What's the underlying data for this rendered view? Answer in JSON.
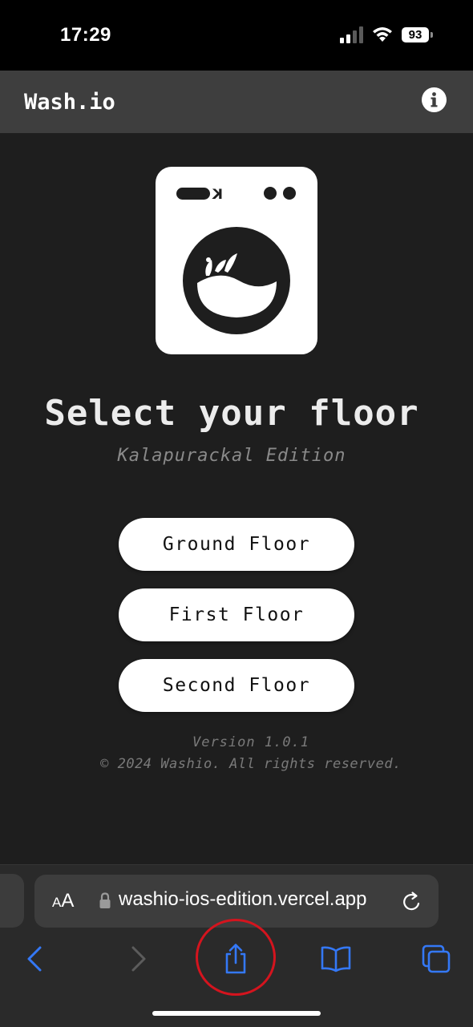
{
  "status_bar": {
    "time": "17:29",
    "battery_level": "93",
    "icons": [
      "signal-icon",
      "wifi-icon",
      "battery-icon"
    ]
  },
  "header": {
    "title": "Wash.io",
    "info_icon": "info-icon"
  },
  "logo": {
    "icon": "washing-machine-logo"
  },
  "main": {
    "title": "Select your floor",
    "subtitle": "Kalapurackal Edition",
    "floors": [
      {
        "label": "Ground Floor"
      },
      {
        "label": "First Floor"
      },
      {
        "label": "Second Floor"
      }
    ]
  },
  "footer": {
    "version": "Version 1.0.1",
    "copyright": "© 2024 Washio. All rights reserved."
  },
  "browser": {
    "aa_label_small": "A",
    "aa_label_large": "A",
    "url": "washio-ios-edition.vercel.app",
    "toolbar": [
      "back-icon",
      "forward-icon",
      "share-icon",
      "bookmarks-icon",
      "tabs-icon"
    ],
    "colors": {
      "accent": "#3478f6",
      "annotation": "#d4141e"
    }
  }
}
